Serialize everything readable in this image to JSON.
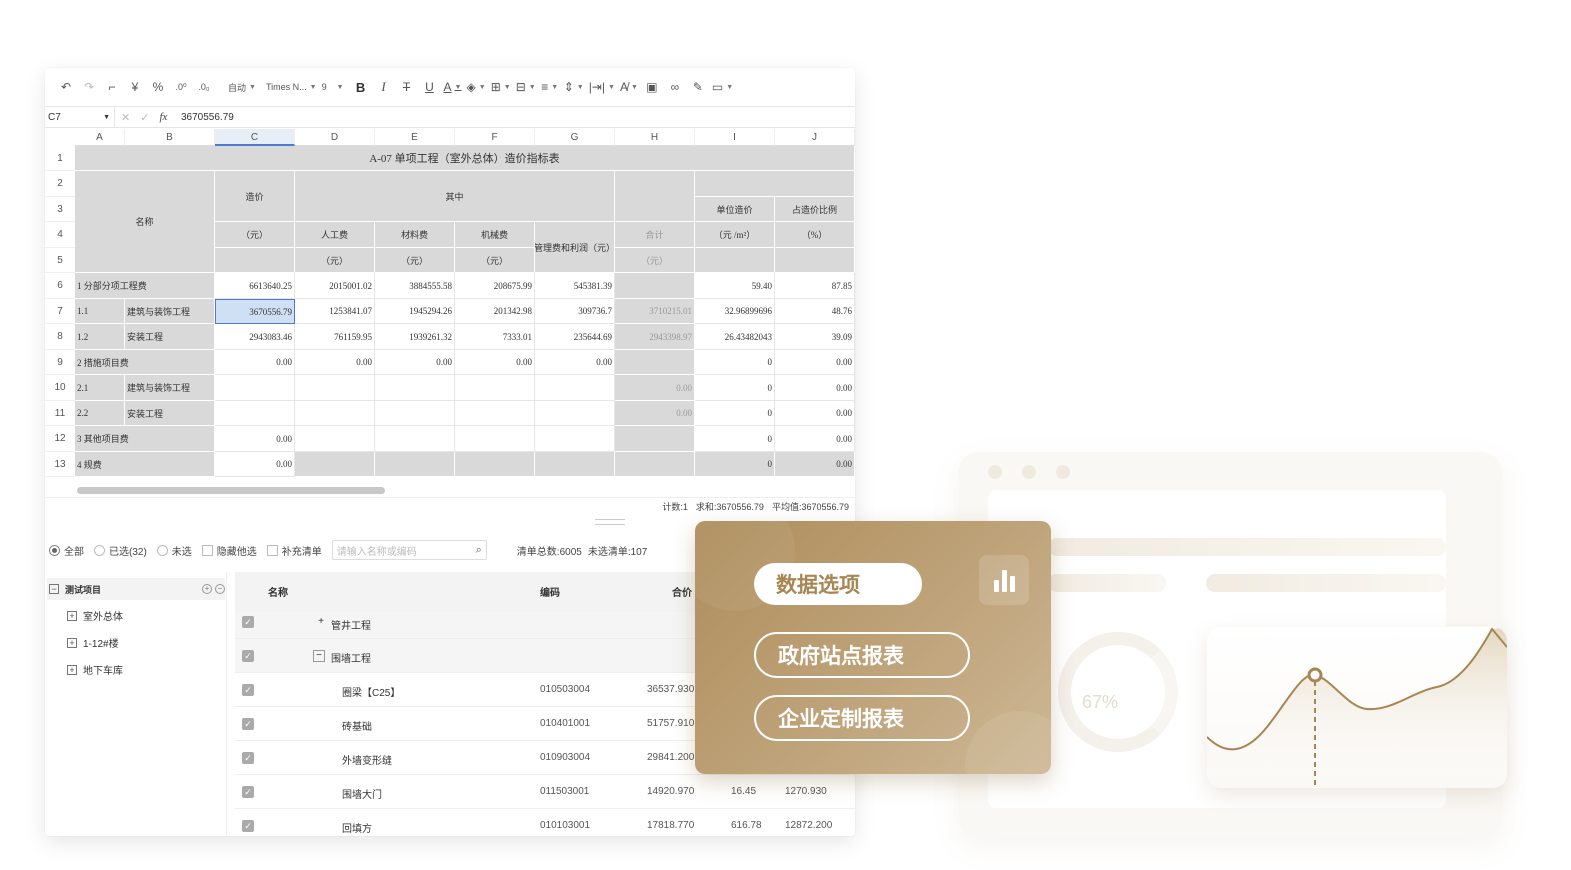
{
  "toolbar": {
    "format_auto": "自动",
    "font_family": "Times N...",
    "font_size": "9",
    "icons": [
      "undo-icon",
      "redo-icon",
      "format-painter-icon",
      "currency-icon",
      "percent-icon",
      "decimal-increase-icon",
      "decimal-decrease-icon",
      "bold-icon",
      "italic-icon",
      "strikethrough-icon",
      "underline-icon",
      "font-color-icon",
      "fill-color-icon",
      "border-icon",
      "merge-icon",
      "align-icon",
      "valign-icon",
      "wrap-icon",
      "text-rotate-icon",
      "image-icon",
      "link-icon",
      "edit-icon",
      "comment-icon"
    ]
  },
  "formula_bar": {
    "cell_ref": "C7",
    "fx": "fx",
    "value": "3670556.79"
  },
  "sheet": {
    "columns": [
      "A",
      "B",
      "C",
      "D",
      "E",
      "F",
      "G",
      "H",
      "I",
      "J"
    ],
    "rows": [
      "1",
      "2",
      "3",
      "4",
      "5",
      "6",
      "7",
      "8",
      "9",
      "10",
      "11",
      "12",
      "13"
    ],
    "title": "A-07 单项工程（室外总体）造价指标表",
    "headers": {
      "name": "名称",
      "cost": "造价",
      "yuan": "（元）",
      "among": "其中",
      "labor": "人工费",
      "material": "材料费",
      "machine": "机械费",
      "mgmt": "管理费和利润（元）",
      "total": "合计",
      "unit_price": "单位造价",
      "unit_price_unit": "（元 /m²）",
      "ratio": "占造价比例",
      "ratio_unit": "（%）"
    },
    "body": [
      {
        "a": "1 分部分项工程费",
        "b": "",
        "c": "6613640.25",
        "d": "2015001.02",
        "e": "3884555.58",
        "f": "208675.99",
        "g": "545381.39",
        "h": "",
        "i": "59.40",
        "j": "87.85"
      },
      {
        "a": "1.1",
        "b": "建筑与装饰工程",
        "c": "3670556.79",
        "d": "1253841.07",
        "e": "1945294.26",
        "f": "201342.98",
        "g": "309736.7",
        "h": "3710215.01",
        "i": "32.96899696",
        "j": "48.76"
      },
      {
        "a": "1.2",
        "b": "安装工程",
        "c": "2943083.46",
        "d": "761159.95",
        "e": "1939261.32",
        "f": "7333.01",
        "g": "235644.69",
        "h": "2943398.97",
        "i": "26.43482043",
        "j": "39.09"
      },
      {
        "a": "2 措施项目费",
        "b": "",
        "c": "0.00",
        "d": "0.00",
        "e": "0.00",
        "f": "0.00",
        "g": "0.00",
        "h": "",
        "i": "0",
        "j": "0.00"
      },
      {
        "a": "2.1",
        "b": "建筑与装饰工程",
        "c": "",
        "d": "",
        "e": "",
        "f": "",
        "g": "",
        "h": "0.00",
        "i": "0",
        "j": "0.00"
      },
      {
        "a": "2.2",
        "b": "安装工程",
        "c": "",
        "d": "",
        "e": "",
        "f": "",
        "g": "",
        "h": "0.00",
        "i": "0",
        "j": "0.00"
      },
      {
        "a": "3 其他项目费",
        "b": "",
        "c": "0.00",
        "d": "",
        "e": "",
        "f": "",
        "g": "",
        "h": "",
        "i": "0",
        "j": "0.00"
      },
      {
        "a": "4 规费",
        "b": "",
        "c": "0.00",
        "d": "",
        "e": "",
        "f": "",
        "g": "",
        "h": "",
        "i": "0",
        "j": "0.00"
      }
    ]
  },
  "status": {
    "count": "计数:1",
    "sum": "求和:3670556.79",
    "avg": "平均值:3670556.79"
  },
  "filter": {
    "all": "全部",
    "selected": "已选(32)",
    "unselected": "未选",
    "hide_other": "隐藏他选",
    "supplement": "补充清单",
    "search_placeholder": "请输入名称或编码",
    "total_label": "清单总数:6005",
    "unselected_count": "未选清单:107"
  },
  "tree": {
    "root": "测试项目",
    "items": [
      "室外总体",
      "1-12#楼",
      "地下车库"
    ]
  },
  "list": {
    "headers": {
      "name": "名称",
      "code": "编码",
      "total": "合价"
    },
    "rows": [
      {
        "name": "管井工程",
        "code": "",
        "total": "",
        "q": "",
        "amt": "",
        "group": true,
        "sign": "+"
      },
      {
        "name": "围墙工程",
        "code": "",
        "total": "",
        "q": "",
        "amt": "",
        "group": true,
        "sign": "−"
      },
      {
        "name": "圈梁【C25】",
        "code": "010503004",
        "total": "36537.930",
        "q": "",
        "amt": ""
      },
      {
        "name": "砖基础",
        "code": "010401001",
        "total": "51757.910",
        "q": "",
        "amt": ""
      },
      {
        "name": "外墙变形缝",
        "code": "010903004",
        "total": "29841.200",
        "q": "",
        "amt": ""
      },
      {
        "name": "围墙大门",
        "code": "011503001",
        "total": "14920.970",
        "q": "16.45",
        "amt": "1270.930"
      },
      {
        "name": "回填方",
        "code": "010103001",
        "total": "17818.770",
        "q": "616.78",
        "amt": "12872.200"
      }
    ]
  },
  "card": {
    "options": [
      "数据选项",
      "政府站点报表",
      "企业定制报表"
    ],
    "icon": "bar-chart-icon",
    "accent": "#ad8d5b"
  },
  "mock": {
    "gauge_label": "67%"
  }
}
